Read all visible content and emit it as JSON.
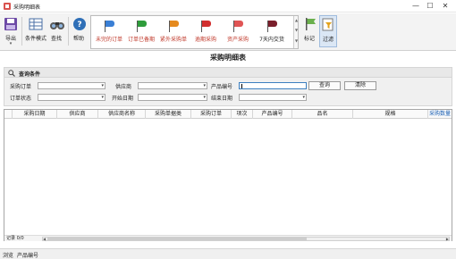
{
  "window": {
    "title": "采购明细表",
    "minimize": "—",
    "maximize": "☐",
    "close": "✕"
  },
  "toolbar": {
    "export": {
      "label": "导出",
      "sub": "▾"
    },
    "condition_mode": {
      "label": "条件模式"
    },
    "find": {
      "label": "查找"
    },
    "help": {
      "label": "帮助"
    },
    "mark": {
      "label": "标记"
    },
    "filter": {
      "label": "过滤"
    }
  },
  "flags": [
    {
      "label": "未完的订单",
      "color": "#3a7fd5",
      "label_color": "#c0392b"
    },
    {
      "label": "订单已备期",
      "color": "#2e9c3b",
      "label_color": "#c0392b"
    },
    {
      "label": "紧外采购单",
      "color": "#e58a1f",
      "label_color": "#c0392b"
    },
    {
      "label": "逾期采购",
      "color": "#d12f2f",
      "label_color": "#c0392b"
    },
    {
      "label": "资产采购",
      "color": "#e05555",
      "label_color": "#c0392b"
    },
    {
      "label": "7天内交货",
      "color": "#7a1f2b",
      "label_color": "#222222"
    }
  ],
  "page_title": "采购明细表",
  "conditions": {
    "header": "查询条件",
    "labels": {
      "order_no": "采购订单",
      "supplier": "供应商",
      "product_no": "产品编号",
      "order_status": "订单状态",
      "start_date": "开始日期",
      "end_date": "结束日期"
    },
    "values": {
      "order_no": "",
      "supplier": "",
      "product_no": "",
      "order_status": "",
      "start_date": "",
      "end_date": ""
    },
    "query_button": "查询",
    "clear_button": "清除"
  },
  "grid": {
    "columns": [
      "采购日期",
      "供应商",
      "供应商名称",
      "采购单据类",
      "采购订单",
      "项次",
      "产品编号",
      "品名",
      "规格",
      "采购数量"
    ],
    "rows": [],
    "record_label": "记录 0/0"
  },
  "statusbar": {
    "left": "浏览",
    "right": "产品编号"
  },
  "colors": {
    "accent": "#3c7fc0",
    "link": "#1a5fb4"
  }
}
